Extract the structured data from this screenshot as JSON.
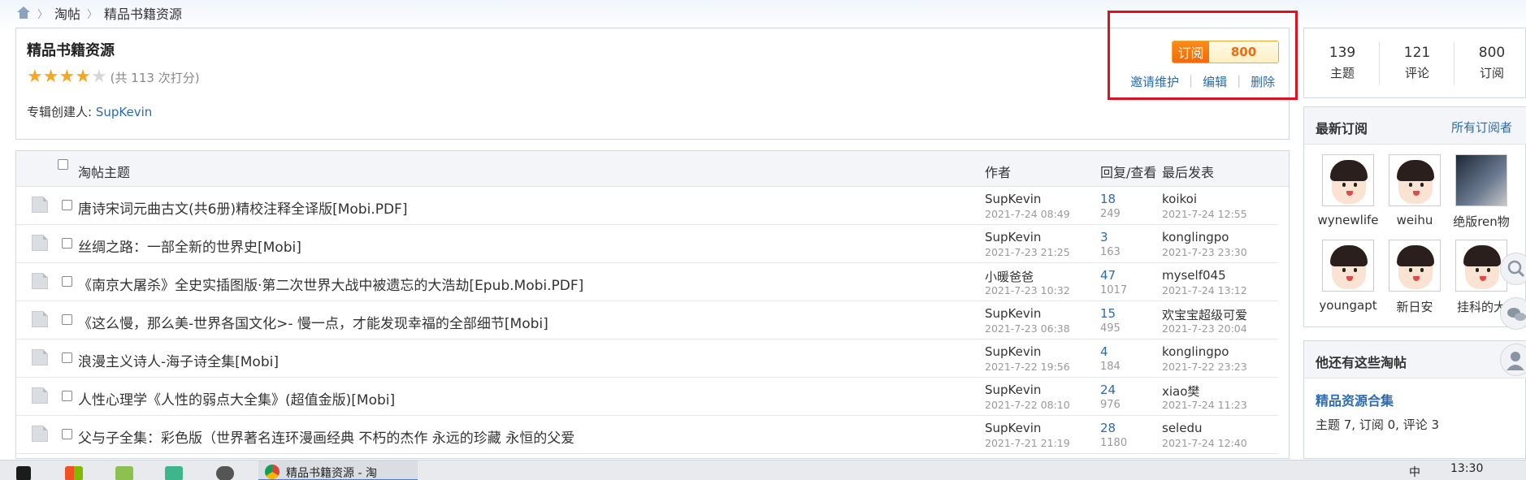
{
  "breadcrumb": {
    "items": [
      "淘帖",
      "精品书籍资源"
    ]
  },
  "collection": {
    "title": "精品书籍资源",
    "rating_text": "(共 113 次打分)",
    "rating_stars": 4,
    "creator_label": "专辑创建人:",
    "creator_name": "SupKevin"
  },
  "subscribe": {
    "label": "订阅",
    "count": "800"
  },
  "actions": [
    "邀请维护",
    "编辑",
    "删除"
  ],
  "table": {
    "headers": {
      "topic": "淘帖主题",
      "author": "作者",
      "reply_view": "回复/查看",
      "last": "最后发表"
    },
    "rows": [
      {
        "title": "唐诗宋词元曲古文(共6册)精校注释全译版[Mobi.PDF]",
        "author": "SupKevin",
        "date": "2021-7-24 08:49",
        "replies": "18",
        "views": "249",
        "last_user": "koikoi",
        "last_date": "2021-7-24 12:55"
      },
      {
        "title": "丝绸之路：一部全新的世界史[Mobi]",
        "author": "SupKevin",
        "date": "2021-7-23 21:25",
        "replies": "3",
        "views": "163",
        "last_user": "konglingpo",
        "last_date": "2021-7-23 23:30"
      },
      {
        "title": "《南京大屠杀》全史实插图版·第二次世界大战中被遗忘的大浩劫[Epub.Mobi.PDF]",
        "author": "小暖爸爸",
        "date": "2021-7-23 10:32",
        "replies": "47",
        "views": "1017",
        "last_user": "myself045",
        "last_date": "2021-7-24 13:12"
      },
      {
        "title": "《这么慢，那么美-世界各国文化>- 慢一点，才能发现幸福的全部细节[Mobi]",
        "author": "SupKevin",
        "date": "2021-7-23 06:38",
        "replies": "15",
        "views": "495",
        "last_user": "欢宝宝超级可爱",
        "last_date": "2021-7-23 20:04"
      },
      {
        "title": "浪漫主义诗人-海子诗全集[Mobi]",
        "author": "SupKevin",
        "date": "2021-7-22 19:56",
        "replies": "4",
        "views": "184",
        "last_user": "konglingpo",
        "last_date": "2021-7-22 23:23"
      },
      {
        "title": "人性心理学《人性的弱点大全集》(超值金版)[Mobi]",
        "author": "SupKevin",
        "date": "2021-7-22 08:10",
        "replies": "24",
        "views": "976",
        "last_user": "xiao樊",
        "last_date": "2021-7-24 11:23"
      },
      {
        "title": "父与子全集：彩色版（世界著名连环漫画经典 不朽的杰作 永远的珍藏 永恒的父爱",
        "author": "SupKevin",
        "date": "2021-7-21 21:19",
        "replies": "28",
        "views": "1180",
        "last_user": "seledu",
        "last_date": "2021-7-24 12:40"
      }
    ]
  },
  "stats": [
    {
      "num": "139",
      "label": "主题"
    },
    {
      "num": "121",
      "label": "评论"
    },
    {
      "num": "800",
      "label": "订阅"
    }
  ],
  "latest_subs": {
    "title": "最新订阅",
    "all_link": "所有订阅者",
    "users": [
      "wynewlife",
      "weihu",
      "绝版ren物",
      "youngapt",
      "新日安",
      "挂科的大"
    ]
  },
  "other": {
    "title": "他还有这些淘帖",
    "link": "精品资源合集",
    "meta": "主题 7, 订阅 0, 评论 3"
  },
  "taskbar": {
    "chrome_tab": "精品书籍资源 - 淘",
    "clock": "13:30",
    "ime": "中"
  },
  "colors": {
    "accent": "#2b6bb2",
    "orange": "#f36a0a",
    "highlight": "#e0101e"
  },
  "icons": [
    "home-icon",
    "doc-icon",
    "search-icon",
    "wechat-icon",
    "user-icon",
    "windows-icon",
    "chrome-icon"
  ]
}
